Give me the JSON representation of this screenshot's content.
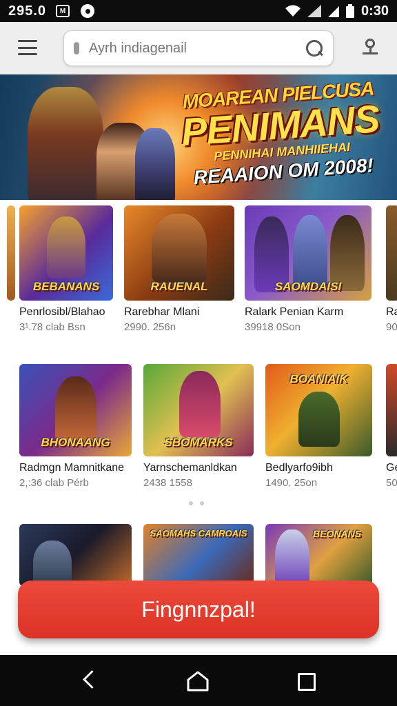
{
  "status_bar": {
    "time_left": "295.0",
    "box_label": "M",
    "time_right": "0:30"
  },
  "search": {
    "placeholder": "Ayrh indiagenail"
  },
  "banner": {
    "line1": "MOAREAN PIELCUSA",
    "line2": "PENIMANS",
    "line3": "PENNIHAI MANHIIEHAI",
    "line4": "REAAION OM 2008!"
  },
  "rows": [
    {
      "cards": [
        {
          "logo": "BEBANANS",
          "title": "Penrlosibl/Blahao",
          "meta": "3¹.78 clab Bsn",
          "colors": [
            "#f5a12c",
            "#5a2a9a",
            "#3b6ad8"
          ]
        },
        {
          "logo": "RAUENAL",
          "title": "Rarebhar Mlani",
          "meta": "2990. 256n",
          "colors": [
            "#e78a2a",
            "#8a3a12",
            "#3a2a1a"
          ]
        },
        {
          "logo": "SAOMDAISI",
          "title": "Ralark Penian Karm",
          "meta": "39918 0Son",
          "colors": [
            "#6a3bb8",
            "#d4a040",
            "#a06a30"
          ]
        },
        {
          "logo": "",
          "title": "Ra",
          "meta": "90",
          "colors": [
            "#8a5a2a",
            "#c07a30",
            "#4a3a20"
          ]
        }
      ]
    },
    {
      "cards": [
        {
          "logo": "BHONAANG",
          "title": "Radmgn  Mamnitkane",
          "meta": "2,:36 clab Pérb",
          "colors": [
            "#3a52b8",
            "#e8a838",
            "#7a2a8a"
          ]
        },
        {
          "logo": "SBOMARKS",
          "title": "Yarnschemanldkan",
          "meta": "2438 1558",
          "colors": [
            "#58a83a",
            "#e0c050",
            "#8a2a5a"
          ]
        },
        {
          "logo": "BOANIAIK",
          "title": "Bedlyarfo9ibh",
          "meta": "1490. 25on",
          "colors": [
            "#e05a1a",
            "#f0b030",
            "#3a5a2a"
          ]
        },
        {
          "logo": "",
          "title": "Ge",
          "meta": "50",
          "colors": [
            "#d04a2a",
            "#3a2a6a",
            "#2a2a2a"
          ]
        }
      ]
    },
    {
      "cards": [
        {
          "logo": "",
          "title": "",
          "meta": "",
          "colors": [
            "#2a3a5a",
            "#c06a2a",
            "#1a1a2a"
          ]
        },
        {
          "logo": "SAOMAHS  CAMROAIS",
          "title": "",
          "meta": "",
          "colors": [
            "#e0822a",
            "#3a6ab8",
            "#6a2a1a"
          ]
        },
        {
          "logo": "BEONANS",
          "title": "",
          "meta": "",
          "colors": [
            "#7a3ab8",
            "#e0a040",
            "#3a5a2a"
          ]
        }
      ]
    }
  ],
  "cta": {
    "label": "Fingnnzpal!"
  }
}
